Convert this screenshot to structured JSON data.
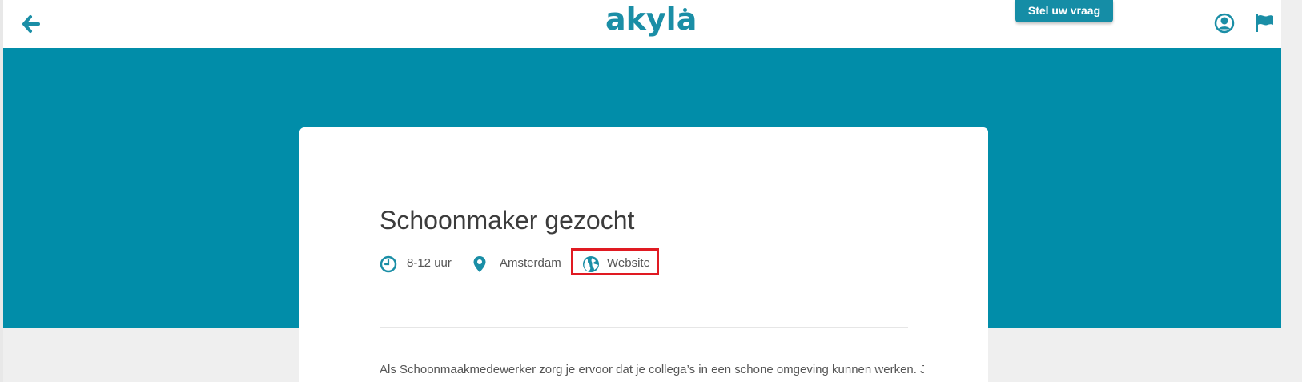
{
  "colors": {
    "brand": "#1a8ea6",
    "hero_background": "#018da9",
    "highlight_border": "#e01a22"
  },
  "header": {
    "logo_text": "akyla",
    "ask_button_label": "Stel uw vraag",
    "icons": [
      "arrow-left-icon",
      "user-circle-icon",
      "flag-icon"
    ]
  },
  "job": {
    "title": "Schoonmaker gezocht",
    "meta": {
      "hours": "8-12 uur",
      "location": "Amsterdam",
      "website_label": "Website"
    },
    "description": "Als Schoonmaakmedewerker zorg je ervoor dat je collega’s in een schone omgeving kunnen werken. Je"
  }
}
